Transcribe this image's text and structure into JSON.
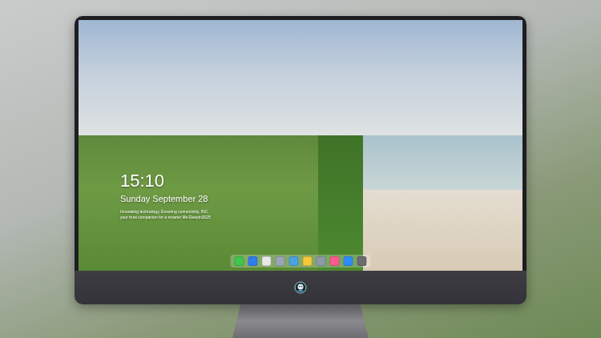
{
  "lock_screen": {
    "time": "15:10",
    "date": "Sunday September 28",
    "info_lines": [
      "Innovating technology, Ensuring connectivity, INC.",
      "your trust companion for a smarter life-Deepin2025"
    ]
  },
  "dock": {
    "items": [
      {
        "name": "messages",
        "color": "#3ec74b"
      },
      {
        "name": "files",
        "color": "#2f7df0"
      },
      {
        "name": "browser",
        "color": "#e8e8e8"
      },
      {
        "name": "settings",
        "color": "#9aa5b5"
      },
      {
        "name": "video",
        "color": "#4aa3e0"
      },
      {
        "name": "notes",
        "color": "#f5c83a"
      },
      {
        "name": "photos",
        "color": "#8c9aa8"
      },
      {
        "name": "music",
        "color": "#ff5b8c"
      },
      {
        "name": "store",
        "color": "#2f8cf5"
      },
      {
        "name": "camera",
        "color": "#6b6b70"
      }
    ]
  }
}
